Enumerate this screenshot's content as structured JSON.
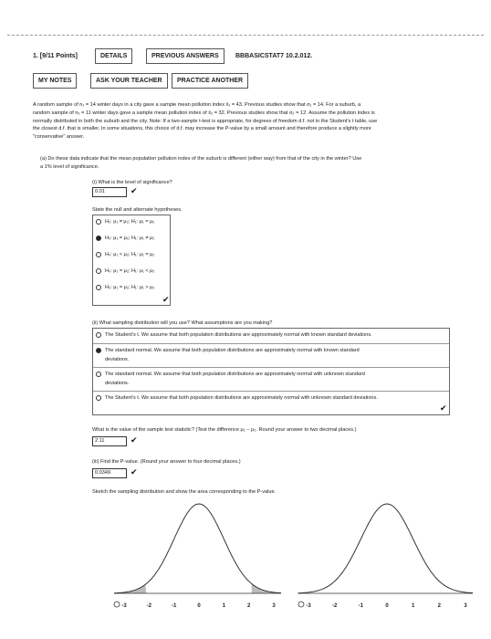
{
  "header": {
    "question_number": "1. [9/11 Points]",
    "details_label": "DETAILS",
    "previous_answers_label": "PREVIOUS ANSWERS",
    "code": "BBBASICSTAT7 10.2.012.",
    "my_notes_label": "MY NOTES",
    "ask_teacher_label": "ASK YOUR TEACHER",
    "practice_another_label": "PRACTICE ANOTHER"
  },
  "problem": {
    "line1": "A random sample of n₁ = 14 winter days in a city gave a sample mean pollution index x̄₁ = 43. Previous studies show that σ₁ = 14. For a suburb, a",
    "line2": "random sample of n₂ = 11 winter days gave a sample mean pollution index of x̄₂ = 32. Previous studies show that σ₂ = 12. Assume the pollution index is",
    "line3": "normally distributed in both the suburb and the city. Note: If a two-sample t-test is appropriate, for degrees of freedom d.f. not in the Student's t table, use",
    "line4": "the closest d.f. that is smaller. In some situations, this choice of d.f. may increase the P-value by a small amount and therefore produce a slightly more",
    "line5": "\"conservative\" answer."
  },
  "part_a": {
    "line1": "(a) Do these data indicate that the mean population pollution index of the suburb is different (either way) from that of the city in the winter? Use",
    "line2": "a 1% level of significance.",
    "q_i": "(i) What is the level of significance?",
    "a_i": "0.01",
    "hyp_prompt": "State the null and alternate hypotheses.",
    "hypotheses": [
      "H₀: μ₁ ≠ μ₂; H₁: μ₁ = μ₂",
      "H₀: μ₁ = μ₂; H₁: μ₁ ≠ μ₂",
      "H₀: μ₁ < μ₂; H₁: μ₁ = μ₂",
      "H₀: μ₁ = μ₂; H₁: μ₁ < μ₂",
      "H₀: μ₁ = μ₂; H₁: μ₁ > μ₂"
    ],
    "hyp_selected": 1,
    "q_ii": "(ii) What sampling distribution will you use? What assumptions are you making?",
    "dists": [
      "The Student's t. We assume that both population distributions are approximately normal with known standard deviations.",
      "The standard normal. We assume that both population distributions are approximately normal with known standard",
      "The standard normal. We assume that both population distributions are approximately normal with unknown standard",
      "The Student's t. We assume that both population distributions are approximately normal with unknown standard deviations."
    ],
    "dist_cont_1": "deviations.",
    "dist_cont_2": "deviations.",
    "dist_selected": 1,
    "q_stat": "What is the value of the sample test statistic? (Test the difference μ₁ − μ₂. Round your answer to two decimal places.)",
    "a_stat": "2.11",
    "q_iii": "(iii) Find the P-value. (Round your answer to four decimal places.)",
    "a_iii": "0.0349",
    "sketch_prompt": "Sketch the sampling distribution and show the area corresponding to the P-value."
  },
  "sketch": {
    "ticks": [
      "-3",
      "-2",
      "-1",
      "0",
      "1",
      "2",
      "3"
    ]
  }
}
